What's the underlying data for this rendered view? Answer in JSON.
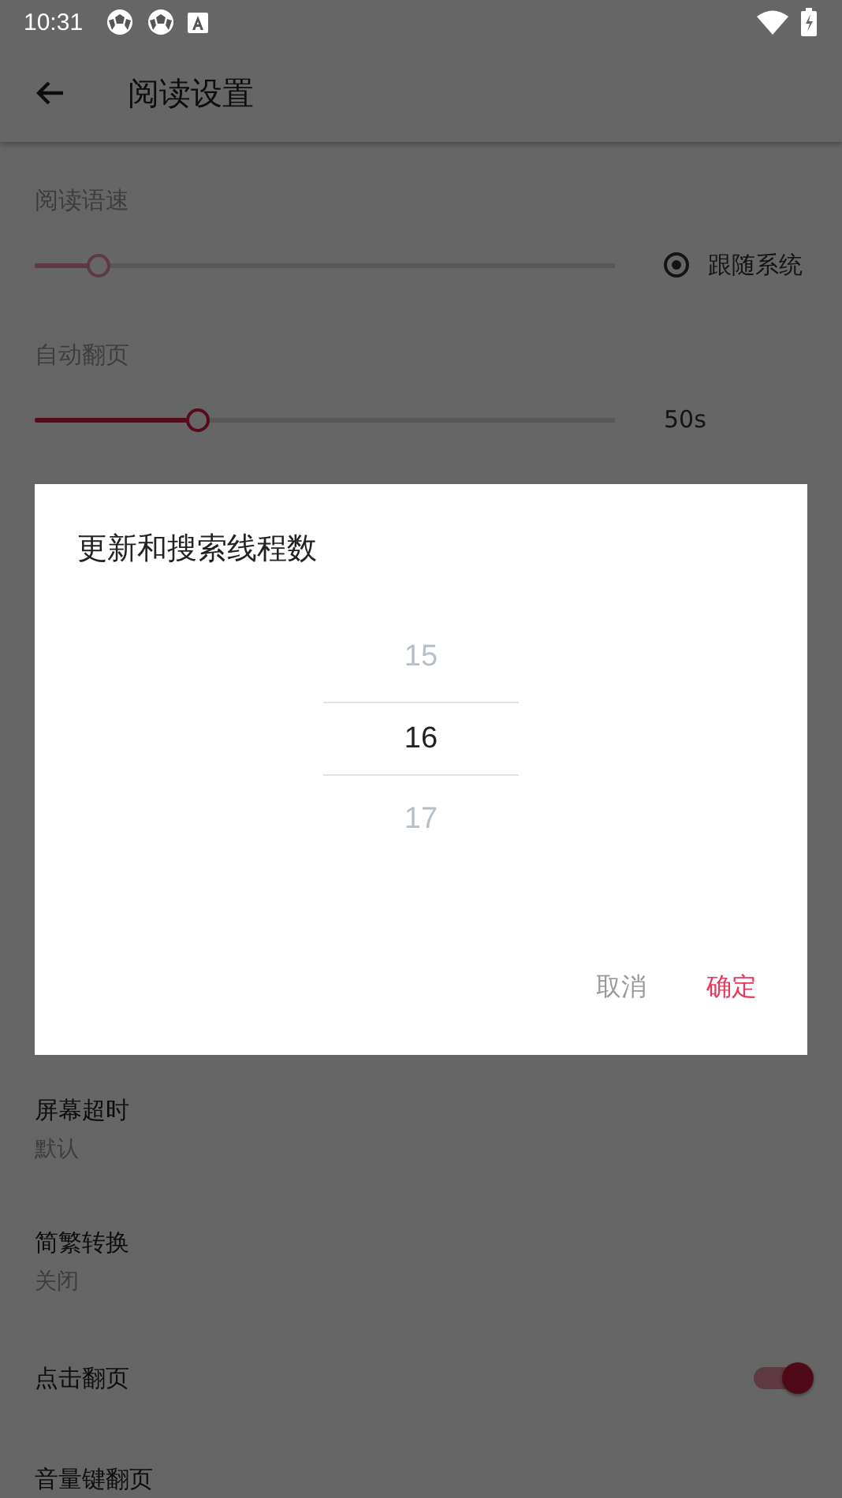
{
  "status_bar": {
    "time": "10:31"
  },
  "app_bar": {
    "title": "阅读设置"
  },
  "speech_rate": {
    "label": "阅读语速",
    "slider": {
      "level": 0.11,
      "disabled": true
    },
    "follow_system": {
      "label": "跟随系统",
      "selected": true
    }
  },
  "auto_page": {
    "label": "自动翻页",
    "slider": {
      "level": 0.28,
      "disabled": false
    },
    "reading": "50s"
  },
  "settings": [
    {
      "kind": "value",
      "title": "屏幕超时",
      "summary": "默认"
    },
    {
      "kind": "value",
      "title": "简繁转换",
      "summary": "关闭"
    },
    {
      "kind": "switch",
      "title": "点击翻页",
      "on": true
    },
    {
      "kind": "switch",
      "title": "音量键翻页"
    }
  ],
  "dialog": {
    "title": "更新和搜索线程数",
    "picker": [
      {
        "label": "15",
        "selected": false
      },
      {
        "label": "16",
        "selected": true
      },
      {
        "label": "17",
        "selected": false
      }
    ],
    "buttons": [
      {
        "label": "取消",
        "kind": "cancel"
      },
      {
        "label": "确定",
        "kind": "confirm"
      }
    ]
  }
}
